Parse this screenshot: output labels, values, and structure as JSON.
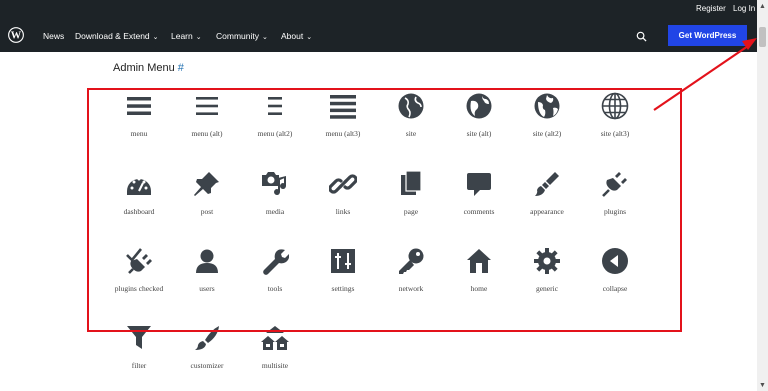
{
  "header": {
    "register": "Register",
    "login": "Log In",
    "nav": [
      {
        "label": "News",
        "chevron": false
      },
      {
        "label": "Download & Extend",
        "chevron": true
      },
      {
        "label": "Learn",
        "chevron": true
      },
      {
        "label": "Community",
        "chevron": true
      },
      {
        "label": "About",
        "chevron": true
      }
    ],
    "get_button": "Get WordPress"
  },
  "section": {
    "title": "Admin Menu",
    "anchor": "#"
  },
  "icons": [
    {
      "label": "menu",
      "icon": "menu-icon"
    },
    {
      "label": "menu (alt)",
      "icon": "menu-alt-icon"
    },
    {
      "label": "menu (alt2)",
      "icon": "menu-alt2-icon"
    },
    {
      "label": "menu (alt3)",
      "icon": "menu-alt3-icon"
    },
    {
      "label": "site",
      "icon": "globe-icon"
    },
    {
      "label": "site (alt)",
      "icon": "globe-alt-icon"
    },
    {
      "label": "site (alt2)",
      "icon": "globe-alt2-icon"
    },
    {
      "label": "site (alt3)",
      "icon": "globe-grid-icon"
    },
    {
      "label": "dashboard",
      "icon": "dashboard-icon"
    },
    {
      "label": "post",
      "icon": "pushpin-icon"
    },
    {
      "label": "media",
      "icon": "camera-music-icon"
    },
    {
      "label": "links",
      "icon": "chain-link-icon"
    },
    {
      "label": "page",
      "icon": "pages-icon"
    },
    {
      "label": "comments",
      "icon": "comment-bubble-icon"
    },
    {
      "label": "appearance",
      "icon": "paintbrush-icon"
    },
    {
      "label": "plugins",
      "icon": "plug-icon"
    },
    {
      "label": "plugins checked",
      "icon": "plug-checked-icon"
    },
    {
      "label": "users",
      "icon": "user-icon"
    },
    {
      "label": "tools",
      "icon": "wrench-icon"
    },
    {
      "label": "settings",
      "icon": "sliders-icon"
    },
    {
      "label": "network",
      "icon": "key-icon"
    },
    {
      "label": "home",
      "icon": "house-icon"
    },
    {
      "label": "generic",
      "icon": "gear-icon"
    },
    {
      "label": "collapse",
      "icon": "collapse-arrow-icon"
    },
    {
      "label": "filter",
      "icon": "funnel-icon"
    },
    {
      "label": "customizer",
      "icon": "brush-icon"
    },
    {
      "label": "multisite",
      "icon": "houses-icon"
    }
  ],
  "colors": {
    "header_bg": "#1d2327",
    "button_bg": "#2145e6",
    "anchor": "#2271b1",
    "icon": "#3c434a",
    "annotation": "#e3121b"
  }
}
